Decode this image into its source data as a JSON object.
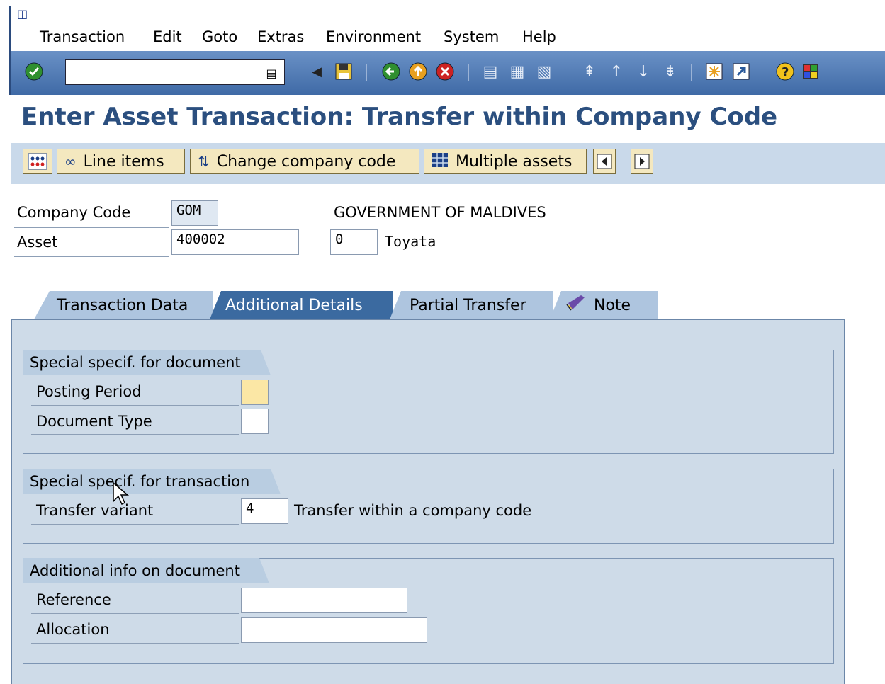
{
  "menu": {
    "items": [
      "Transaction",
      "Edit",
      "Goto",
      "Extras",
      "Environment",
      "System",
      "Help"
    ]
  },
  "toolbar": {
    "command_value": "",
    "icons": [
      "enter-icon",
      "save-icon",
      "back-icon",
      "exit-icon",
      "cancel-icon",
      "print-icon",
      "find-icon",
      "find-next-icon",
      "first-page-icon",
      "previous-page-icon",
      "next-page-icon",
      "last-page-icon",
      "new-session-icon",
      "shortcut-icon",
      "help-icon",
      "layout-icon"
    ]
  },
  "title": "Enter Asset Transaction: Transfer within Company Code",
  "app_toolbar": {
    "line_items": "Line items",
    "change_company_code": "Change company code",
    "multiple_assets": "Multiple assets"
  },
  "header": {
    "company_code_label": "Company Code",
    "company_code_value": "GOM",
    "company_name": "GOVERNMENT OF MALDIVES",
    "asset_label": "Asset",
    "asset_value": "400002",
    "sub_number_value": "0",
    "asset_description": "Toyata"
  },
  "tabs": [
    "Transaction Data",
    "Additional Details",
    "Partial Transfer",
    "Note"
  ],
  "groups": {
    "document": {
      "title": "Special specif. for document",
      "posting_period_label": "Posting Period",
      "posting_period_value": "",
      "document_type_label": "Document Type",
      "document_type_value": ""
    },
    "transaction": {
      "title": "Special specif. for transaction",
      "transfer_variant_label": "Transfer variant",
      "transfer_variant_value": "4",
      "transfer_variant_desc": "Transfer within a company code"
    },
    "additional": {
      "title": "Additional info on document",
      "reference_label": "Reference",
      "reference_value": "",
      "allocation_label": "Allocation",
      "allocation_value": ""
    }
  },
  "colors": {
    "title": "#2b4f7f",
    "toolbar": "#4f7ab5",
    "tab_active": "#3b6aa0",
    "required_field": "#fbe7a5"
  }
}
